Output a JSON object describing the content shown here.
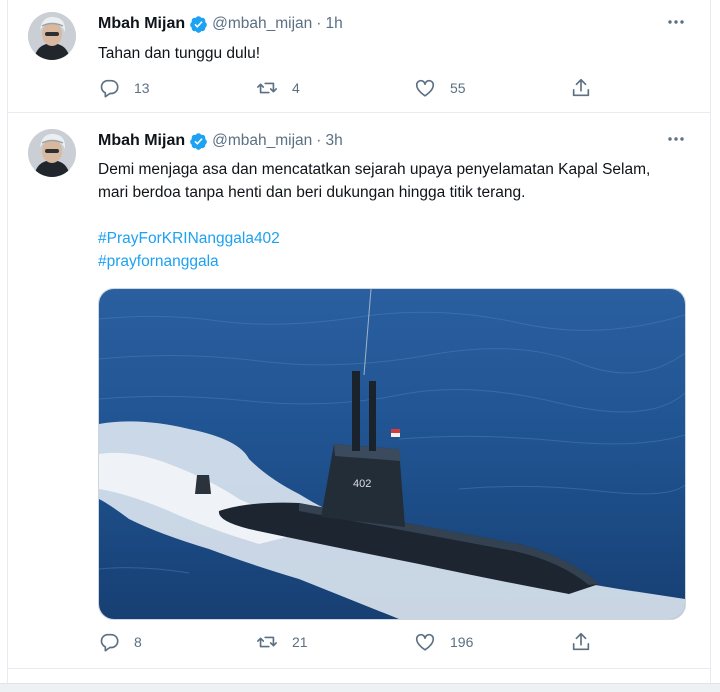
{
  "tweets": [
    {
      "author": {
        "name": "Mbah Mijan",
        "handle": "@mbah_mijan",
        "verified": true
      },
      "time": "1h",
      "text": "Tahan dan tunggu dulu!",
      "hashtags": [],
      "stats": {
        "replies": "13",
        "retweets": "4",
        "likes": "55"
      }
    },
    {
      "author": {
        "name": "Mbah Mijan",
        "handle": "@mbah_mijan",
        "verified": true
      },
      "time": "3h",
      "text": "Demi menjaga asa dan mencatatkan sejarah upaya penyelamatan Kapal Selam, mari berdoa tanpa henti dan beri dukungan hingga titik terang.",
      "hashtags": [
        "#PrayForKRINanggala402",
        "#prayfornanggala"
      ],
      "media": {
        "hull_number": "402"
      },
      "stats": {
        "replies": "8",
        "retweets": "21",
        "likes": "196"
      }
    }
  ],
  "separator": "·",
  "colors": {
    "accent": "#1da1f2",
    "secondary_text": "#5b7083",
    "border": "#e6ecf0"
  },
  "icons": [
    "verified-badge-icon",
    "more-icon",
    "reply-icon",
    "retweet-icon",
    "like-icon",
    "share-icon"
  ]
}
